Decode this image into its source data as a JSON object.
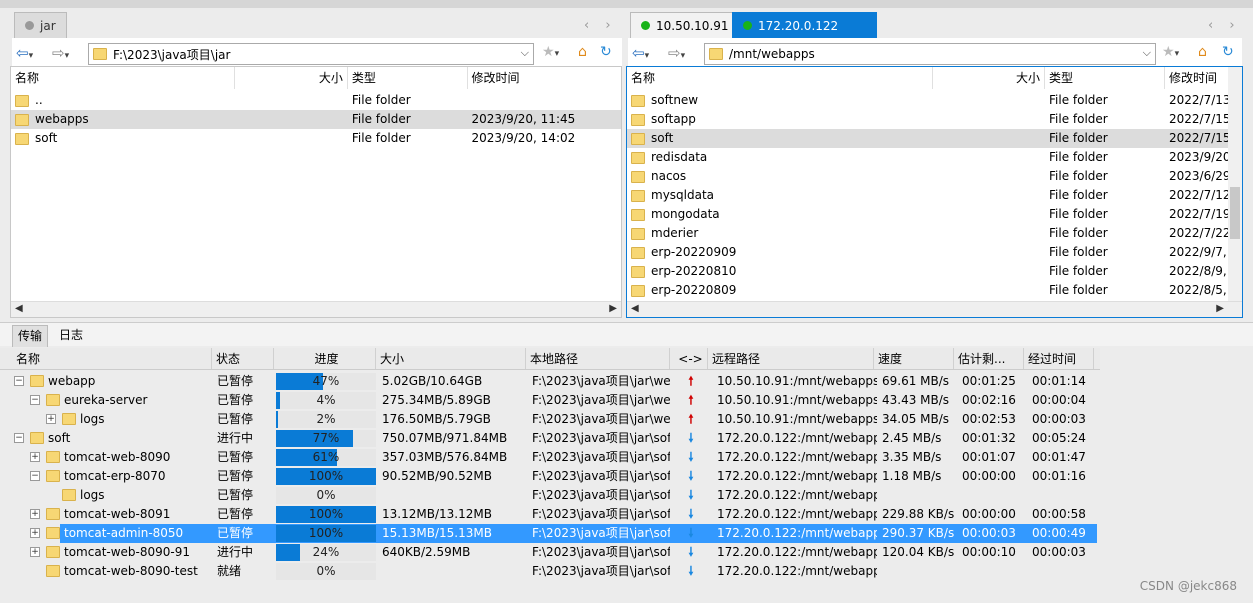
{
  "left_tab": {
    "label": "jar"
  },
  "right_tabs": [
    {
      "label": "10.50.10.91",
      "dot": "#19b319"
    },
    {
      "label": "172.20.0.122",
      "dot": "#19b319"
    }
  ],
  "left_path": "F:\\2023\\java项目\\jar",
  "right_path": "/mnt/webapps",
  "columns": {
    "name": "名称",
    "size": "大小",
    "type": "类型",
    "modified": "修改时间"
  },
  "left_files": [
    {
      "name": "..",
      "type": "File folder",
      "modified": ""
    },
    {
      "name": "webapps",
      "type": "File folder",
      "modified": "2023/9/20, 11:45"
    },
    {
      "name": "soft",
      "type": "File folder",
      "modified": "2023/9/20, 14:02"
    }
  ],
  "right_files": [
    {
      "name": "softnew",
      "type": "File folder",
      "modified": "2022/7/13,"
    },
    {
      "name": "softapp",
      "type": "File folder",
      "modified": "2022/7/15,"
    },
    {
      "name": "soft",
      "type": "File folder",
      "modified": "2022/7/15,"
    },
    {
      "name": "redisdata",
      "type": "File folder",
      "modified": "2023/9/20,"
    },
    {
      "name": "nacos",
      "type": "File folder",
      "modified": "2023/6/29,"
    },
    {
      "name": "mysqldata",
      "type": "File folder",
      "modified": "2022/7/12,"
    },
    {
      "name": "mongodata",
      "type": "File folder",
      "modified": "2022/7/19,"
    },
    {
      "name": "mderier",
      "type": "File folder",
      "modified": "2022/7/22,"
    },
    {
      "name": "erp-20220909",
      "type": "File folder",
      "modified": "2022/9/7,"
    },
    {
      "name": "erp-20220810",
      "type": "File folder",
      "modified": "2022/8/9,"
    },
    {
      "name": "erp-20220809",
      "type": "File folder",
      "modified": "2022/8/5,"
    }
  ],
  "bottom_tabs": {
    "transfer": "传输",
    "log": "日志"
  },
  "transfer_columns": {
    "name": "名称",
    "status": "状态",
    "progress": "进度",
    "size": "大小",
    "local": "本地路径",
    "dir": "<->",
    "remote": "远程路径",
    "speed": "速度",
    "eta": "估计剩...",
    "elapsed": "经过时间"
  },
  "transfers": [
    {
      "name": "webapp",
      "status": "已暂停",
      "progress": 0.47,
      "pct": "47%",
      "size": "5.02GB/10.64GB",
      "local": "F:\\2023\\java项目\\jar\\we...",
      "dir": "up",
      "remote": "10.50.10.91:/mnt/webapps/...",
      "speed": "69.61 MB/s",
      "eta": "00:01:25",
      "elapsed": "00:01:14"
    },
    {
      "name": "eureka-server",
      "status": "已暂停",
      "progress": 0.04,
      "pct": "4%",
      "size": "275.34MB/5.89GB",
      "local": "F:\\2023\\java项目\\jar\\we...",
      "dir": "up",
      "remote": "10.50.10.91:/mnt/webapps/...",
      "speed": "43.43 MB/s",
      "eta": "00:02:16",
      "elapsed": "00:00:04"
    },
    {
      "name": "logs",
      "status": "已暂停",
      "progress": 0.02,
      "pct": "2%",
      "size": "176.50MB/5.79GB",
      "local": "F:\\2023\\java项目\\jar\\we...",
      "dir": "up",
      "remote": "10.50.10.91:/mnt/webapps/...",
      "speed": "34.05 MB/s",
      "eta": "00:02:53",
      "elapsed": "00:00:03"
    },
    {
      "name": "soft",
      "status": "进行中",
      "progress": 0.77,
      "pct": "77%",
      "size": "750.07MB/971.84MB",
      "local": "F:\\2023\\java项目\\jar\\soft",
      "dir": "down",
      "remote": "172.20.0.122:/mnt/webapps...",
      "speed": "2.45 MB/s",
      "eta": "00:01:32",
      "elapsed": "00:05:24"
    },
    {
      "name": "tomcat-web-8090",
      "status": "已暂停",
      "progress": 0.61,
      "pct": "61%",
      "size": "357.03MB/576.84MB",
      "local": "F:\\2023\\java项目\\jar\\sof...",
      "dir": "down",
      "remote": "172.20.0.122:/mnt/webapps...",
      "speed": "3.35 MB/s",
      "eta": "00:01:07",
      "elapsed": "00:01:47"
    },
    {
      "name": "tomcat-erp-8070",
      "status": "已暂停",
      "progress": 1.0,
      "pct": "100%",
      "size": "90.52MB/90.52MB",
      "local": "F:\\2023\\java项目\\jar\\sof...",
      "dir": "down",
      "remote": "172.20.0.122:/mnt/webapps...",
      "speed": "1.18 MB/s",
      "eta": "00:00:00",
      "elapsed": "00:01:16"
    },
    {
      "name": "logs",
      "status": "已暂停",
      "progress": 0.0,
      "pct": "0%",
      "size": "",
      "local": "F:\\2023\\java项目\\jar\\sof...",
      "dir": "down",
      "remote": "172.20.0.122:/mnt/webapps...",
      "speed": "",
      "eta": "",
      "elapsed": ""
    },
    {
      "name": "tomcat-web-8091",
      "status": "已暂停",
      "progress": 1.0,
      "pct": "100%",
      "size": "13.12MB/13.12MB",
      "local": "F:\\2023\\java项目\\jar\\sof...",
      "dir": "down",
      "remote": "172.20.0.122:/mnt/webapps...",
      "speed": "229.88 KB/s",
      "eta": "00:00:00",
      "elapsed": "00:00:58"
    },
    {
      "name": "tomcat-admin-8050",
      "status": "已暂停",
      "progress": 1.0,
      "pct": "100%",
      "size": "15.13MB/15.13MB",
      "local": "F:\\2023\\java项目\\jar\\sof...",
      "dir": "down",
      "remote": "172.20.0.122:/mnt/webapps...",
      "speed": "290.37 KB/s",
      "eta": "00:00:03",
      "elapsed": "00:00:49"
    },
    {
      "name": "tomcat-web-8090-91",
      "status": "进行中",
      "progress": 0.24,
      "pct": "24%",
      "size": "640KB/2.59MB",
      "local": "F:\\2023\\java项目\\jar\\sof...",
      "dir": "down",
      "remote": "172.20.0.122:/mnt/webapps...",
      "speed": "120.04 KB/s",
      "eta": "00:00:10",
      "elapsed": "00:00:03"
    },
    {
      "name": "tomcat-web-8090-test",
      "status": "就绪",
      "progress": 0.0,
      "pct": "0%",
      "size": "",
      "local": "F:\\2023\\java项目\\jar\\sof...",
      "dir": "down",
      "remote": "172.20.0.122:/mnt/webapps...",
      "speed": "",
      "eta": "",
      "elapsed": ""
    }
  ],
  "watermark": "CSDN @jekc868"
}
